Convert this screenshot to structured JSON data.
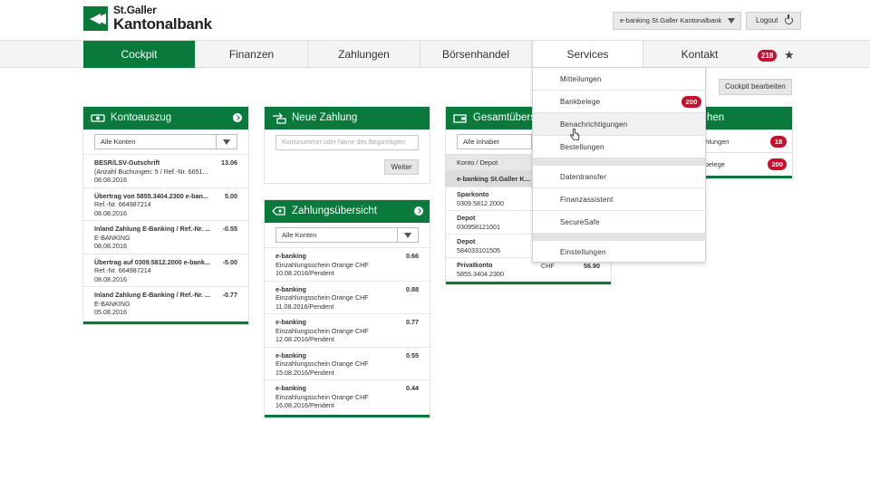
{
  "brand": {
    "line1": "St.Galler",
    "line2": "Kantonalbank"
  },
  "header": {
    "account_select": "e-banking St.Galler Kantonalbank",
    "logout_label": "Logout"
  },
  "nav": {
    "items": [
      {
        "label": "Cockpit"
      },
      {
        "label": "Finanzen"
      },
      {
        "label": "Zahlungen"
      },
      {
        "label": "Börsenhandel"
      },
      {
        "label": "Services"
      },
      {
        "label": "Kontakt"
      }
    ],
    "messages_badge": "218"
  },
  "edit_cockpit_label": "Cockpit bearbeiten",
  "kontoauszug": {
    "title": "Kontoauszug",
    "filter": "Alle Konten",
    "rows": [
      {
        "title": "BESR/LSV-Gutschrift",
        "amount": "13.06",
        "line2": "(Anzahl Buchungen: 5 / Ref.-Nr. 6651...",
        "date": "08.08.2016"
      },
      {
        "title": "Übertrag von 5855.3404.2300 e-ban...",
        "amount": "5.00",
        "line2": "Ref.-Nr. 664987214",
        "date": "08.08.2016"
      },
      {
        "title": "Inland Zahlung E-Banking / Ref.-Nr. ...",
        "amount": "-0.55",
        "line2": "E-BANKING",
        "date": "08.08.2016"
      },
      {
        "title": "Übertrag auf 0309.5812.2000 e-bank...",
        "amount": "-5.00",
        "line2": "Ref.-Nr. 664987214",
        "date": "08.08.2016"
      },
      {
        "title": "Inland Zahlung E-Banking / Ref.-Nr. ...",
        "amount": "-0.77",
        "line2": "E-BANKING",
        "date": "05.08.2016"
      }
    ]
  },
  "neue_zahlung": {
    "title": "Neue Zahlung",
    "placeholder": "Kontonummer oder Name des Begünstigten",
    "button": "Weiter"
  },
  "zahlungsuebersicht": {
    "title": "Zahlungsübersicht",
    "filter": "Alle Konten",
    "rows": [
      {
        "title": "e-banking",
        "amount": "0.66",
        "line2": "Einzahlungsschein Orange CHF",
        "date": "10.08.2016/Pendent"
      },
      {
        "title": "e-banking",
        "amount": "0.88",
        "line2": "Einzahlungsschein Orange CHF",
        "date": "11.08.2016/Pendent"
      },
      {
        "title": "e-banking",
        "amount": "0.77",
        "line2": "Einzahlungsschein Orange CHF",
        "date": "12.08.2016/Pendent"
      },
      {
        "title": "e-banking",
        "amount": "0.55",
        "line2": "Einzahlungsschein Orange CHF",
        "date": "15.08.2016/Pendent"
      },
      {
        "title": "e-banking",
        "amount": "0.44",
        "line2": "Einzahlungsschein Orange CHF",
        "date": "16.08.2016/Pendent"
      }
    ]
  },
  "gesamtuebersicht": {
    "title": "Gesamtübers",
    "filter": "Alle Inhaber",
    "head": "Konto / Depot",
    "group": "e-banking St.Galler K...",
    "rows": [
      {
        "name": "Sparkonto",
        "number": "0309.5812.2000",
        "currency": "",
        "amount": ""
      },
      {
        "name": "Depot",
        "number": "030958121001",
        "currency": "",
        "amount": ""
      },
      {
        "name": "Depot",
        "number": "584033101505",
        "currency": "",
        "amount": ""
      },
      {
        "name": "Privatkonto",
        "number": "5855.3404.2300",
        "currency": "CHF",
        "amount": "56.90"
      }
    ]
  },
  "mitteilungen_panel": {
    "title": "hen",
    "rows": [
      {
        "label": "ahlungen",
        "badge": "18"
      },
      {
        "label": "kbelege",
        "badge": "200"
      }
    ]
  },
  "services_menu": {
    "group1": [
      {
        "label": "Mitteilungen",
        "badge": ""
      },
      {
        "label": "Bankbelege",
        "badge": "200"
      },
      {
        "label": "Benachrichtigungen",
        "badge": ""
      },
      {
        "label": "Bestellungen",
        "badge": ""
      }
    ],
    "group2": [
      {
        "label": "Datentransfer"
      },
      {
        "label": "Finanzassistent"
      },
      {
        "label": "SecureSafe"
      }
    ],
    "group3": [
      {
        "label": "Einstellungen"
      }
    ]
  },
  "colors": {
    "brand_green": "#0a7a3c",
    "badge_red": "#c8102e"
  }
}
